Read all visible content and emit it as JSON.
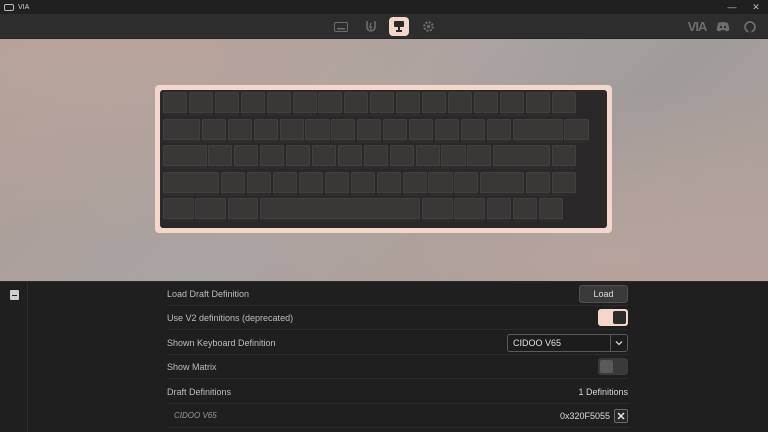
{
  "window": {
    "title": "VIA",
    "controls": {
      "minimize": "—",
      "maximize": "☐",
      "close": "✕"
    }
  },
  "nav": {
    "icons": [
      "keyboard-icon",
      "lightning-icon",
      "debug-icon",
      "gear-icon"
    ],
    "active": "debug-icon",
    "brand": "VIA",
    "right_icons": [
      "discord-icon",
      "github-icon"
    ]
  },
  "settings": {
    "rows": [
      {
        "label": "Load Draft Definition",
        "control": "button",
        "button_label": "Load"
      },
      {
        "label": "Use V2 definitions (deprecated)",
        "control": "toggle",
        "value": true
      },
      {
        "label": "Shown Keyboard Definition",
        "control": "select",
        "selected": "CIDOO V65"
      },
      {
        "label": "Show Matrix",
        "control": "toggle",
        "value": false
      },
      {
        "label": "Draft Definitions",
        "control": "count",
        "count_text": "1 Definitions"
      }
    ],
    "drafts": [
      {
        "name": "CIDOO V65",
        "vendor_product_id": "0x320F5055"
      }
    ]
  },
  "colors": {
    "accent": "#f3d7cc",
    "background": "#1f1f1f",
    "keycap": "#3a3737"
  }
}
